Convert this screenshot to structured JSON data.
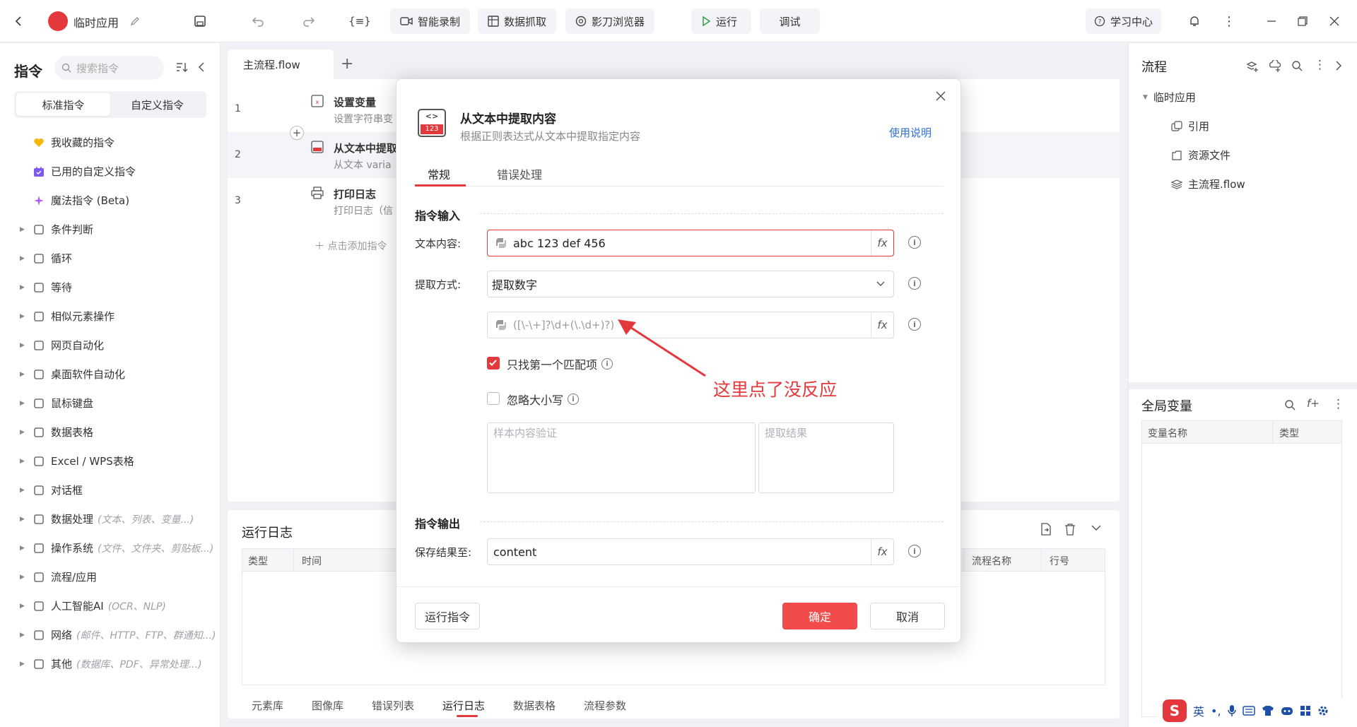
{
  "topbar": {
    "app_title": "临时应用",
    "buttons": {
      "smart_record": "智能录制",
      "data_capture": "数据抓取",
      "browser": "影刀浏览器",
      "run": "运行",
      "debug": "调试",
      "learning_center": "学习中心"
    }
  },
  "left": {
    "title": "指令",
    "search_placeholder": "搜索指令",
    "tabs": [
      "标准指令",
      "自定义指令"
    ],
    "items": [
      {
        "label": "我收藏的指令",
        "hint": "",
        "icon": "heart-icon",
        "arrow": false
      },
      {
        "label": "已用的自定义指令",
        "hint": "",
        "icon": "custom-cmd-icon",
        "arrow": false
      },
      {
        "label": "魔法指令 (Beta)",
        "hint": "",
        "icon": "magic-icon",
        "arrow": false
      },
      {
        "label": "条件判断",
        "hint": "",
        "icon": "branch-icon",
        "arrow": true
      },
      {
        "label": "循环",
        "hint": "",
        "icon": "loop-icon",
        "arrow": true
      },
      {
        "label": "等待",
        "hint": "",
        "icon": "hourglass-icon",
        "arrow": true
      },
      {
        "label": "相似元素操作",
        "hint": "",
        "icon": "similar-icon",
        "arrow": true
      },
      {
        "label": "网页自动化",
        "hint": "",
        "icon": "globe-icon",
        "arrow": true
      },
      {
        "label": "桌面软件自动化",
        "hint": "",
        "icon": "desktop-icon",
        "arrow": true
      },
      {
        "label": "鼠标键盘",
        "hint": "",
        "icon": "cursor-icon",
        "arrow": true
      },
      {
        "label": "数据表格",
        "hint": "",
        "icon": "doc-icon",
        "arrow": true
      },
      {
        "label": "Excel / WPS表格",
        "hint": "",
        "icon": "excel-icon",
        "arrow": true
      },
      {
        "label": "对话框",
        "hint": "",
        "icon": "dialog-icon",
        "arrow": true
      },
      {
        "label": "数据处理",
        "hint": "(文本、列表、变量...)",
        "icon": "data-icon",
        "arrow": true
      },
      {
        "label": "操作系统",
        "hint": "(文件、文件夹、剪贴板...)",
        "icon": "os-icon",
        "arrow": true
      },
      {
        "label": "流程/应用",
        "hint": "",
        "icon": "layers-icon",
        "arrow": true
      },
      {
        "label": "人工智能AI",
        "hint": "(OCR、NLP)",
        "icon": "ai-icon",
        "arrow": true
      },
      {
        "label": "网络",
        "hint": "(邮件、HTTP、FTP、群通知...)",
        "icon": "network-icon",
        "arrow": true
      },
      {
        "label": "其他",
        "hint": "(数据库、PDF、异常处理...)",
        "icon": "grid-icon",
        "arrow": true
      }
    ]
  },
  "editor": {
    "tab": "主流程.flow",
    "rows": [
      {
        "num": "1",
        "title": "设置变量",
        "desc": "设置字符串变"
      },
      {
        "num": "2",
        "title": "从文本中提取",
        "desc": "从文本 varia"
      },
      {
        "num": "3",
        "title": "打印日志",
        "desc": "打印日志（信"
      }
    ],
    "add_hint": "点击添加指令"
  },
  "runlog": {
    "title": "运行日志",
    "columns_left": [
      "类型",
      "时间"
    ],
    "columns_right": [
      "流程名称",
      "行号"
    ],
    "bottom_tabs": [
      "元素库",
      "图像库",
      "错误列表",
      "运行日志",
      "数据表格",
      "流程参数"
    ]
  },
  "right": {
    "title": "流程",
    "tree": {
      "root": "临时应用",
      "children": [
        "引用",
        "资源文件",
        "主流程.flow"
      ]
    },
    "gv_title": "全局变量",
    "gv_columns": [
      "变量名称",
      "类型"
    ]
  },
  "dialog": {
    "icon_text": "123",
    "title": "从文本中提取内容",
    "subtitle": "根据正则表达式从文本中提取指定内容",
    "help": "使用说明",
    "tabs": [
      "常规",
      "错误处理"
    ],
    "section_input": "指令输入",
    "text_label": "文本内容:",
    "text_value": "abc 123 def 456",
    "mode_label": "提取方式:",
    "mode_value": "提取数字",
    "regex_placeholder": "([\\-\\+]?\\d+(\\.\\d+)?)",
    "first_match": "只找第一个匹配项",
    "ignore_case": "忽略大小写",
    "sample_placeholder": "样本内容验证",
    "result_placeholder": "提取结果",
    "section_output": "指令输出",
    "save_label": "保存结果至:",
    "save_value": "content",
    "run_btn": "运行指令",
    "ok_btn": "确定",
    "cancel_btn": "取消"
  },
  "annotation": "这里点了没反应",
  "ime": {
    "lang": "英"
  }
}
